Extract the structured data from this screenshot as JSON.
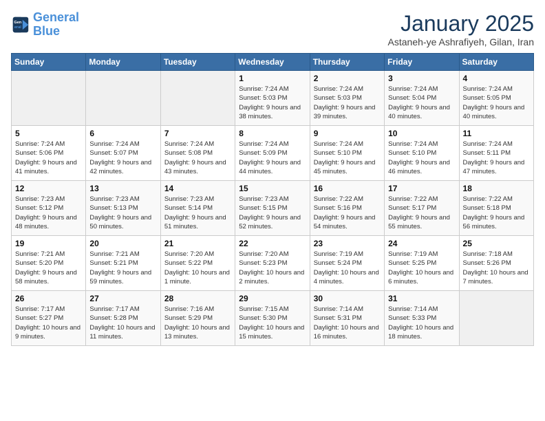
{
  "header": {
    "logo_line1": "General",
    "logo_line2": "Blue",
    "title": "January 2025",
    "subtitle": "Astaneh-ye Ashrafiyeh, Gilan, Iran"
  },
  "weekdays": [
    "Sunday",
    "Monday",
    "Tuesday",
    "Wednesday",
    "Thursday",
    "Friday",
    "Saturday"
  ],
  "weeks": [
    [
      {
        "day": null
      },
      {
        "day": null
      },
      {
        "day": null
      },
      {
        "day": "1",
        "sunrise": "7:24 AM",
        "sunset": "5:03 PM",
        "daylight": "9 hours and 38 minutes."
      },
      {
        "day": "2",
        "sunrise": "7:24 AM",
        "sunset": "5:03 PM",
        "daylight": "9 hours and 39 minutes."
      },
      {
        "day": "3",
        "sunrise": "7:24 AM",
        "sunset": "5:04 PM",
        "daylight": "9 hours and 40 minutes."
      },
      {
        "day": "4",
        "sunrise": "7:24 AM",
        "sunset": "5:05 PM",
        "daylight": "9 hours and 40 minutes."
      }
    ],
    [
      {
        "day": "5",
        "sunrise": "7:24 AM",
        "sunset": "5:06 PM",
        "daylight": "9 hours and 41 minutes."
      },
      {
        "day": "6",
        "sunrise": "7:24 AM",
        "sunset": "5:07 PM",
        "daylight": "9 hours and 42 minutes."
      },
      {
        "day": "7",
        "sunrise": "7:24 AM",
        "sunset": "5:08 PM",
        "daylight": "9 hours and 43 minutes."
      },
      {
        "day": "8",
        "sunrise": "7:24 AM",
        "sunset": "5:09 PM",
        "daylight": "9 hours and 44 minutes."
      },
      {
        "day": "9",
        "sunrise": "7:24 AM",
        "sunset": "5:10 PM",
        "daylight": "9 hours and 45 minutes."
      },
      {
        "day": "10",
        "sunrise": "7:24 AM",
        "sunset": "5:10 PM",
        "daylight": "9 hours and 46 minutes."
      },
      {
        "day": "11",
        "sunrise": "7:24 AM",
        "sunset": "5:11 PM",
        "daylight": "9 hours and 47 minutes."
      }
    ],
    [
      {
        "day": "12",
        "sunrise": "7:23 AM",
        "sunset": "5:12 PM",
        "daylight": "9 hours and 48 minutes."
      },
      {
        "day": "13",
        "sunrise": "7:23 AM",
        "sunset": "5:13 PM",
        "daylight": "9 hours and 50 minutes."
      },
      {
        "day": "14",
        "sunrise": "7:23 AM",
        "sunset": "5:14 PM",
        "daylight": "9 hours and 51 minutes."
      },
      {
        "day": "15",
        "sunrise": "7:23 AM",
        "sunset": "5:15 PM",
        "daylight": "9 hours and 52 minutes."
      },
      {
        "day": "16",
        "sunrise": "7:22 AM",
        "sunset": "5:16 PM",
        "daylight": "9 hours and 54 minutes."
      },
      {
        "day": "17",
        "sunrise": "7:22 AM",
        "sunset": "5:17 PM",
        "daylight": "9 hours and 55 minutes."
      },
      {
        "day": "18",
        "sunrise": "7:22 AM",
        "sunset": "5:18 PM",
        "daylight": "9 hours and 56 minutes."
      }
    ],
    [
      {
        "day": "19",
        "sunrise": "7:21 AM",
        "sunset": "5:20 PM",
        "daylight": "9 hours and 58 minutes."
      },
      {
        "day": "20",
        "sunrise": "7:21 AM",
        "sunset": "5:21 PM",
        "daylight": "9 hours and 59 minutes."
      },
      {
        "day": "21",
        "sunrise": "7:20 AM",
        "sunset": "5:22 PM",
        "daylight": "10 hours and 1 minute."
      },
      {
        "day": "22",
        "sunrise": "7:20 AM",
        "sunset": "5:23 PM",
        "daylight": "10 hours and 2 minutes."
      },
      {
        "day": "23",
        "sunrise": "7:19 AM",
        "sunset": "5:24 PM",
        "daylight": "10 hours and 4 minutes."
      },
      {
        "day": "24",
        "sunrise": "7:19 AM",
        "sunset": "5:25 PM",
        "daylight": "10 hours and 6 minutes."
      },
      {
        "day": "25",
        "sunrise": "7:18 AM",
        "sunset": "5:26 PM",
        "daylight": "10 hours and 7 minutes."
      }
    ],
    [
      {
        "day": "26",
        "sunrise": "7:17 AM",
        "sunset": "5:27 PM",
        "daylight": "10 hours and 9 minutes."
      },
      {
        "day": "27",
        "sunrise": "7:17 AM",
        "sunset": "5:28 PM",
        "daylight": "10 hours and 11 minutes."
      },
      {
        "day": "28",
        "sunrise": "7:16 AM",
        "sunset": "5:29 PM",
        "daylight": "10 hours and 13 minutes."
      },
      {
        "day": "29",
        "sunrise": "7:15 AM",
        "sunset": "5:30 PM",
        "daylight": "10 hours and 15 minutes."
      },
      {
        "day": "30",
        "sunrise": "7:14 AM",
        "sunset": "5:31 PM",
        "daylight": "10 hours and 16 minutes."
      },
      {
        "day": "31",
        "sunrise": "7:14 AM",
        "sunset": "5:33 PM",
        "daylight": "10 hours and 18 minutes."
      },
      {
        "day": null
      }
    ]
  ]
}
